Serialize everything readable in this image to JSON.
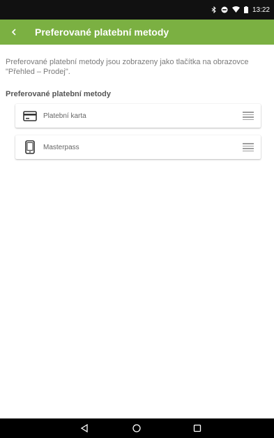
{
  "status_bar": {
    "time": "13:22",
    "icons": [
      "bluetooth-icon",
      "do-not-disturb-icon",
      "wifi-icon",
      "battery-icon"
    ]
  },
  "app_bar": {
    "title": "Preferované platební metody",
    "back_icon": "chevron-left-icon",
    "color": "#7bb042"
  },
  "description": "Preferované platební metody jsou zobrazeny jako tlačítka na obrazovce \"Přehled – Prodej\".",
  "section_title": "Preferované platební metody",
  "methods": [
    {
      "label": "Platební karta",
      "icon": "credit-card-icon"
    },
    {
      "label": "Masterpass",
      "icon": "smartphone-icon"
    }
  ],
  "nav_bar": {
    "icons": [
      "back-triangle-icon",
      "home-circle-icon",
      "recents-square-icon"
    ]
  }
}
